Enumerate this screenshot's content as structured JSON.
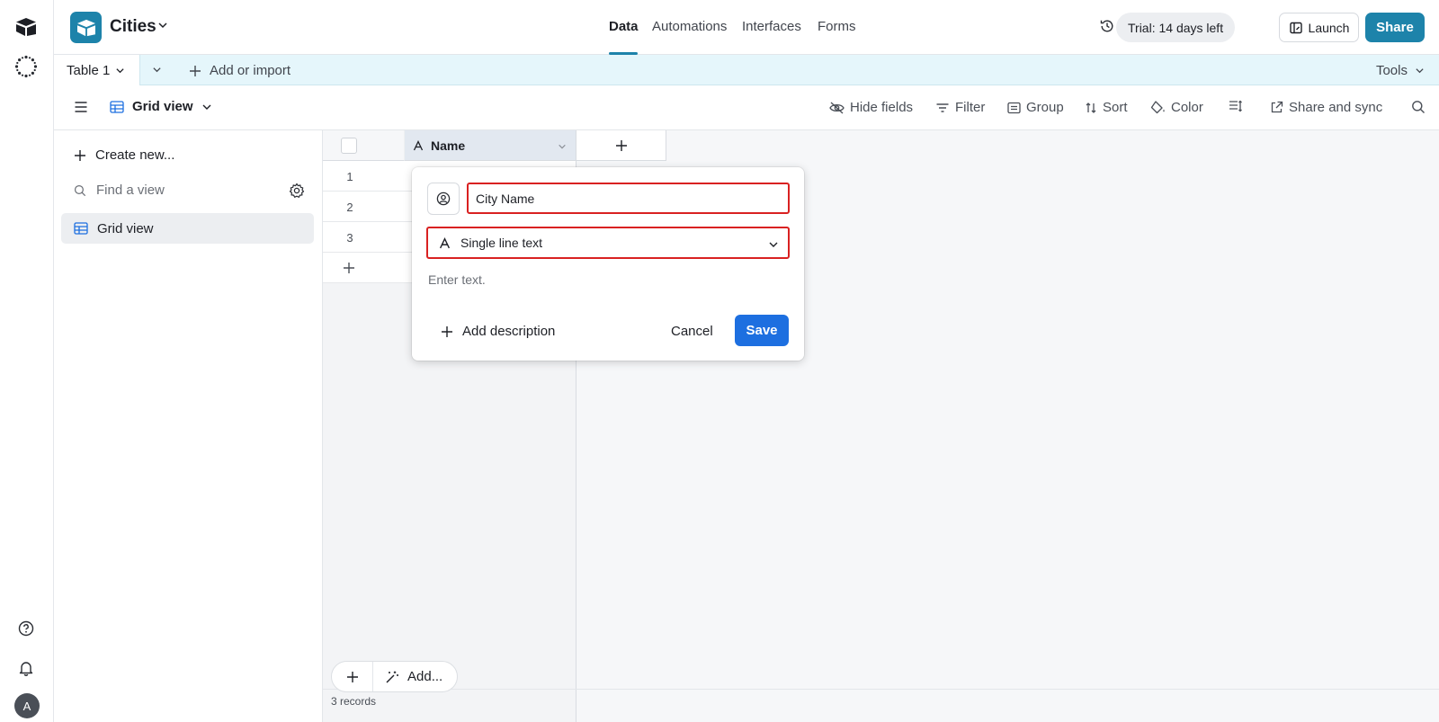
{
  "base": {
    "name": "Cities"
  },
  "nav": {
    "tabs": [
      "Data",
      "Automations",
      "Interfaces",
      "Forms"
    ],
    "active": "Data"
  },
  "header": {
    "trial_label": "Trial: 14 days left",
    "launch_label": "Launch",
    "share_label": "Share"
  },
  "tables": {
    "active_tab": "Table 1",
    "add_import_label": "Add or import",
    "tools_label": "Tools"
  },
  "viewbar": {
    "view_name": "Grid view",
    "tools": [
      "Hide fields",
      "Filter",
      "Group",
      "Sort",
      "Color",
      "Share and sync"
    ]
  },
  "sidebar": {
    "create_label": "Create new...",
    "find_placeholder": "Find a view",
    "views": [
      "Grid view"
    ]
  },
  "grid": {
    "column_name": "Name",
    "rows": [
      "1",
      "2",
      "3"
    ],
    "add_label": "Add...",
    "records_label": "3 records"
  },
  "field_dialog": {
    "field_name_value": "City Name",
    "field_type_label": "Single line text",
    "hint_text": "Enter text.",
    "add_description_label": "Add description",
    "cancel_label": "Cancel",
    "save_label": "Save"
  },
  "user": {
    "avatar_initial": "A"
  },
  "colors": {
    "brand": "#1d83aa",
    "save": "#1d6fe0",
    "highlight_border": "#d92121",
    "tabs_bg": "#e5f6fb"
  }
}
